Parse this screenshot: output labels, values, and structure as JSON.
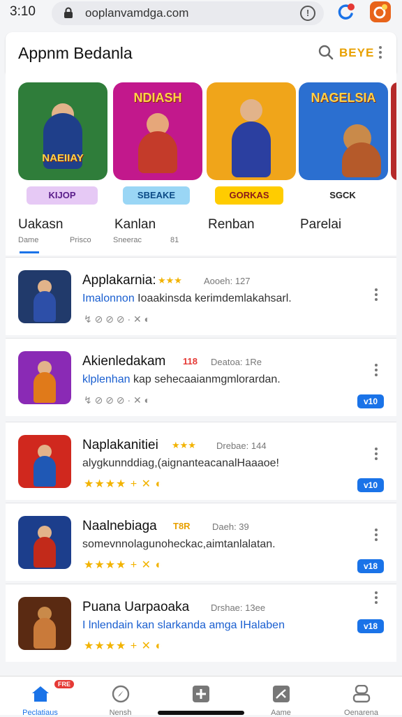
{
  "status": {
    "time": "3:10"
  },
  "browser": {
    "url": "ooplanvamdga.com"
  },
  "appbar": {
    "title": "Appnm Bedanla",
    "badge": "BEYE"
  },
  "featured": [
    {
      "art_title": "NAEIIAY",
      "pill": "KIJOP",
      "name": "Uakasn",
      "meta": "Dame",
      "bg": "#2f7d3a",
      "fig": "#1f3f8a",
      "pill_bg": "#e6c9f5",
      "pill_fg": "#5a1d8a"
    },
    {
      "art_title": "NDIASH",
      "pill": "SBEAKE",
      "name": "Kanlan",
      "meta": "Prisco",
      "bg": "#c2188c",
      "fig": "#c43b2a",
      "pill_bg": "#9ad6f5",
      "pill_fg": "#0b4a86"
    },
    {
      "art_title": "",
      "pill": "GORKAS",
      "name": "Renban",
      "meta": "Sneerac",
      "bg": "#f0a51a",
      "fig": "#2b3fa0",
      "pill_bg": "#ffcc00",
      "pill_fg": "#8a1a1a"
    },
    {
      "art_title": "NAGELSIA",
      "pill": "SGCK",
      "name": "Parelai",
      "meta": "81",
      "bg": "#2b6fd0",
      "fig": "#b55a2a",
      "pill_bg": "#ffffff",
      "pill_fg": "#222222"
    }
  ],
  "list": [
    {
      "title": "Applakarnia:",
      "stars": "★★★",
      "meta": "Aooeh: 127",
      "desc_hl": "Imalonnon",
      "desc": " Ioaakinsda kerimdemlakahsarl.",
      "row": "↯ ⊘ ⊘ ⊘ · ✕ ◐",
      "rating": "",
      "version": "",
      "bg": "#213a6b",
      "fig": "#2d4fa8"
    },
    {
      "title": "Akienledakam",
      "stars": "118",
      "meta": "Deatoa: 1Re",
      "desc_hl": "klplenhan",
      "desc": " kap sehecaaianmgmlorardan.",
      "row": "↯ ⊘ ⊘ ⊘ · ✕ ◐",
      "rating": "",
      "version": "v10",
      "bg": "#8a2ab5",
      "fig": "#e07a1a"
    },
    {
      "title": "Naplakanitiei",
      "stars": "★★★",
      "meta": "Drebae: 144",
      "desc_hl": "",
      "desc": "alygkunnddiag,(aignanteacanalHaaaoe!",
      "row": "",
      "rating": "★★★★ + ✕ ◐",
      "version": "v10",
      "bg": "#d0281e",
      "fig": "#1f58b5"
    },
    {
      "title": "Naalnebiaga",
      "stars": "T8R",
      "meta": "Daeh: 39",
      "desc_hl": "",
      "desc": "somevnnolagunoheckac,aimtanlalatan.",
      "row": "",
      "rating": "★★★★ + ✕ ◐",
      "version": "v18",
      "bg": "#1c3e8c",
      "fig": "#c22a1a"
    },
    {
      "title": "Puana Uarpaoaka",
      "stars": "",
      "meta": "Drshae: 13ee",
      "desc_hl": "I lnlendain",
      "desc": " kan slarkanda amga IHalaben",
      "row": "",
      "rating": "★★★★ + ✕ ◐",
      "version": "v18",
      "bg": "#5a2a12",
      "fig": "#c97a3a"
    }
  ],
  "nav": [
    {
      "label": "Peclatiaus",
      "badge": "FRE",
      "active": true
    },
    {
      "label": "Nensh",
      "badge": "",
      "active": false
    },
    {
      "label": "",
      "badge": "",
      "active": false
    },
    {
      "label": "Aame",
      "badge": "",
      "active": false
    },
    {
      "label": "Oenarena",
      "badge": "",
      "active": false
    }
  ]
}
